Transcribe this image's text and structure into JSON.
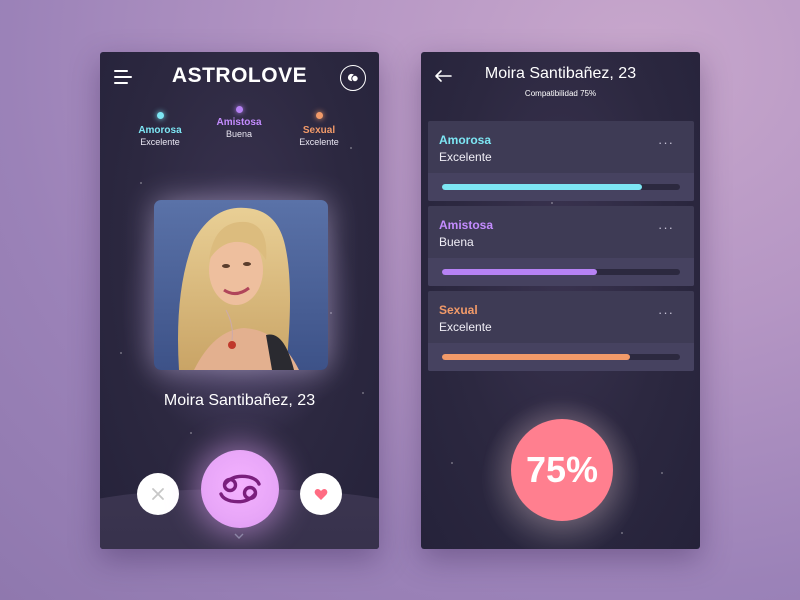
{
  "left": {
    "app_title": "ASTROLOVE",
    "categories": [
      {
        "name": "Amorosa",
        "value": "Excelente",
        "color": "#7de6f4"
      },
      {
        "name": "Amistosa",
        "value": "Buena",
        "color": "#b682f4"
      },
      {
        "name": "Sexual",
        "value": "Excelente",
        "color": "#f29a69"
      }
    ],
    "profile_name": "Moira Santibañez, 23",
    "icons": {
      "menu": "menu-icon",
      "chat": "chat-bubbles-icon",
      "dislike": "close-icon",
      "zodiac": "cancer-zodiac-icon",
      "like": "heart-icon",
      "more": "chevron-down-icon"
    },
    "colors": {
      "accent": "#efa9ff",
      "like": "#ff6b82",
      "dislike": "#c7c7c7"
    }
  },
  "right": {
    "title": "Moira Santibañez, 23",
    "subtitle": "Compatibilidad 75%",
    "cards": [
      {
        "name": "Amorosa",
        "value": "Excelente",
        "level": 0.84,
        "color": "#7de6f4",
        "more": "···"
      },
      {
        "name": "Amistosa",
        "value": "Buena",
        "level": 0.65,
        "color": "#b682f4",
        "more": "···"
      },
      {
        "name": "Sexual",
        "value": "Excelente",
        "level": 0.79,
        "color": "#f29a69",
        "more": "···"
      }
    ],
    "compatibility": "75%",
    "icons": {
      "back": "arrow-left-icon",
      "more": "more-dots-icon"
    },
    "colors": {
      "percent_circle": "#ff7f8f"
    }
  }
}
